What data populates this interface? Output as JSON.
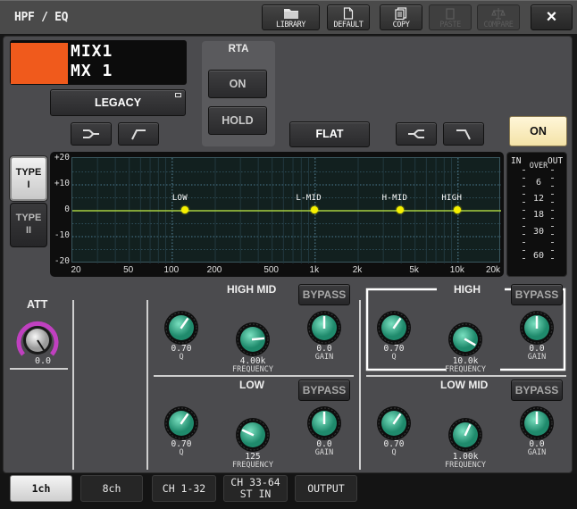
{
  "window": {
    "title": "HPF / EQ"
  },
  "toolbar": {
    "library": "LIBRARY",
    "default": "DEFAULT",
    "copy": "COPY",
    "paste": "PASTE",
    "compare": "COMPARE",
    "close_icon": "×"
  },
  "channel": {
    "color": "#f05a1c",
    "name_line1": "MIX1",
    "name_line2": "MX 1"
  },
  "library_mode": "LEGACY",
  "rta": {
    "title": "RTA",
    "on": "ON",
    "hold": "HOLD"
  },
  "flat": "FLAT",
  "eq_on": "ON",
  "eq_type": {
    "type1": "TYPE\nI",
    "type2": "TYPE\nII",
    "type1_l1": "TYPE",
    "type1_l2": "I",
    "type2_l1": "TYPE",
    "type2_l2": "II",
    "selected": "TYPE I"
  },
  "graph": {
    "y_ticks": [
      "+20",
      "+10",
      "0",
      "-10",
      "-20"
    ],
    "x_ticks": [
      "20",
      "50",
      "100",
      "200",
      "500",
      "1k",
      "2k",
      "5k",
      "10k",
      "20k"
    ],
    "bands": [
      {
        "label": "LOW",
        "freq_hz": 125,
        "gain_db": 0
      },
      {
        "label": "L-MID",
        "freq_hz": 1000,
        "gain_db": 0
      },
      {
        "label": "H-MID",
        "freq_hz": 4000,
        "gain_db": 0
      },
      {
        "label": "HIGH",
        "freq_hz": 10000,
        "gain_db": 0
      }
    ],
    "curve_color": "#a8d040",
    "point_color": "#f6f000"
  },
  "meter": {
    "in": "IN",
    "out": "OUT",
    "scale": [
      "OVER",
      "6",
      "12",
      "18",
      "30",
      "60"
    ]
  },
  "att": {
    "label": "ATT",
    "value": "0.0"
  },
  "sections": {
    "high_mid": {
      "title": "HIGH MID",
      "bypass": "BYPASS",
      "q": "0.70",
      "q_label": "Q",
      "freq": "4.00k",
      "freq_label": "FREQUENCY",
      "gain": "0.0",
      "gain_label": "GAIN"
    },
    "high": {
      "title": "HIGH",
      "bypass": "BYPASS",
      "q": "0.70",
      "q_label": "Q",
      "freq": "10.0k",
      "freq_label": "FREQUENCY",
      "gain": "0.0",
      "gain_label": "GAIN"
    },
    "low": {
      "title": "LOW",
      "bypass": "BYPASS",
      "q": "0.70",
      "q_label": "Q",
      "freq": "125",
      "freq_label": "FREQUENCY",
      "gain": "0.0",
      "gain_label": "GAIN"
    },
    "low_mid": {
      "title": "LOW MID",
      "bypass": "BYPASS",
      "q": "0.70",
      "q_label": "Q",
      "freq": "1.00k",
      "freq_label": "FREQUENCY",
      "gain": "0.0",
      "gain_label": "GAIN"
    }
  },
  "tabs": [
    {
      "label": "1ch",
      "active": true
    },
    {
      "label": "8ch",
      "active": false
    },
    {
      "label": "CH 1-32",
      "active": false
    },
    {
      "label": "CH 33-64",
      "label2": "ST IN",
      "active": false
    },
    {
      "label": "OUTPUT",
      "active": false
    }
  ]
}
